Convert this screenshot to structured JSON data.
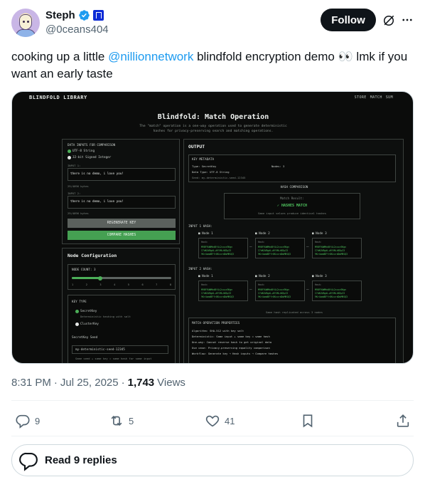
{
  "author": {
    "name": "Steph",
    "handle": "@0ceans404"
  },
  "header": {
    "follow_label": "Follow",
    "icons": [
      "grok-icon",
      "more-icon",
      "verified-badge-icon",
      "affiliation-badge-icon"
    ]
  },
  "tweet": {
    "text_before": "cooking up a little ",
    "mention": "@nillionnetwork",
    "text_after": " blindfold encryption demo 👀 lmk if you want an early taste"
  },
  "media": {
    "app_title": "BLINDFOLD LIBRARY",
    "nav": [
      "STORE",
      "MATCH",
      "SUM"
    ],
    "heading": "Blindfold: Match Operation",
    "subheading": "The \"match\" operation is a one-way operation used to generate deterministic hashes for privacy-preserving search and matching operations.",
    "inputs": {
      "section_label": "DATA INPUTS FOR COMPARISON",
      "type_options": [
        "UTF-8 String",
        "32-bit Signed Integer"
      ],
      "input1_label": "INPUT 1:",
      "input1_value": "there is no demo, i love you!",
      "input1_bytes": "29/4096 bytes",
      "input2_label": "INPUT 2:",
      "input2_value": "there is no demo, i love you!",
      "input2_bytes": "29/4096 bytes",
      "regenerate_label": "REGENERATE KEY",
      "compare_label": "COMPARE HASHES"
    },
    "node_config": {
      "title": "Node Configuration",
      "node_count_label": "NODE COUNT: 3",
      "node_count": 3,
      "node_count_max": 8,
      "ticks": [
        "1",
        "2",
        "3",
        "4",
        "5",
        "6",
        "7",
        "8"
      ],
      "key_type_label": "KEY TYPE",
      "key_secret": "SecretKey",
      "key_secret_desc": "Deterministic hashing with salt",
      "key_cluster": "ClusterKey",
      "seed_label": "SecretKey Seed",
      "seed_value": "my-deterministic-seed-12345",
      "seed_hint": "Same seed + same key = same hash for same input"
    },
    "output": {
      "title": "OUTPUT",
      "key_metadata_label": "KEY METADATA",
      "type_label": "Type: SecretKey",
      "nodes_label": "Nodes: 3",
      "data_type_label": "Data Type: UTF-8 String",
      "seed_label": "Seed: my-deterministic-seed-12345",
      "hash_comparison_label": "HASH COMPARISON",
      "match_result_label": "Match Result:",
      "match_result": "✓ HASHES MATCH",
      "match_note": "Same input values produce identical hashes",
      "input1_hash_label": "INPUT 1 HASH:",
      "input2_hash_label": "INPUT 2 HASH:",
      "node_labels": [
        "■ Node 1",
        "■ Node 2",
        "■ Node 3"
      ],
      "hash_prefix": "Hash:",
      "hash_lines": [
        "M9BF9UWMhdBf4i2cxzz9Kgn",
        "I7dKUV8gdL+HYVM+hB3pI3",
        "9Kr4omdBFfr8KcxrdDoMRSQ3"
      ],
      "replicated_note": "Same hash replicated across 3 nodes",
      "properties_label": "MATCH OPERATION PROPERTIES",
      "properties": [
        "Algorithm: SHA-512 with key salt",
        "Deterministic: Same input + same key = same hash",
        "One-way: Cannot reverse hash to get original data",
        "Use case: Privacy-preserving equality comparison",
        "Workflow: Generate key → Hash inputs → Compare hashes"
      ]
    }
  },
  "meta": {
    "time": "8:31 PM",
    "separator": "·",
    "date": "Jul 25, 2025",
    "views_count": "1,743",
    "views_label": "Views"
  },
  "actions": {
    "replies": "9",
    "reposts": "5",
    "likes": "41"
  },
  "read_replies_label": "Read 9 replies",
  "colors": {
    "accent": "#1d9bf0",
    "text": "#0f1419",
    "muted": "#536471",
    "green": "#45a052"
  }
}
